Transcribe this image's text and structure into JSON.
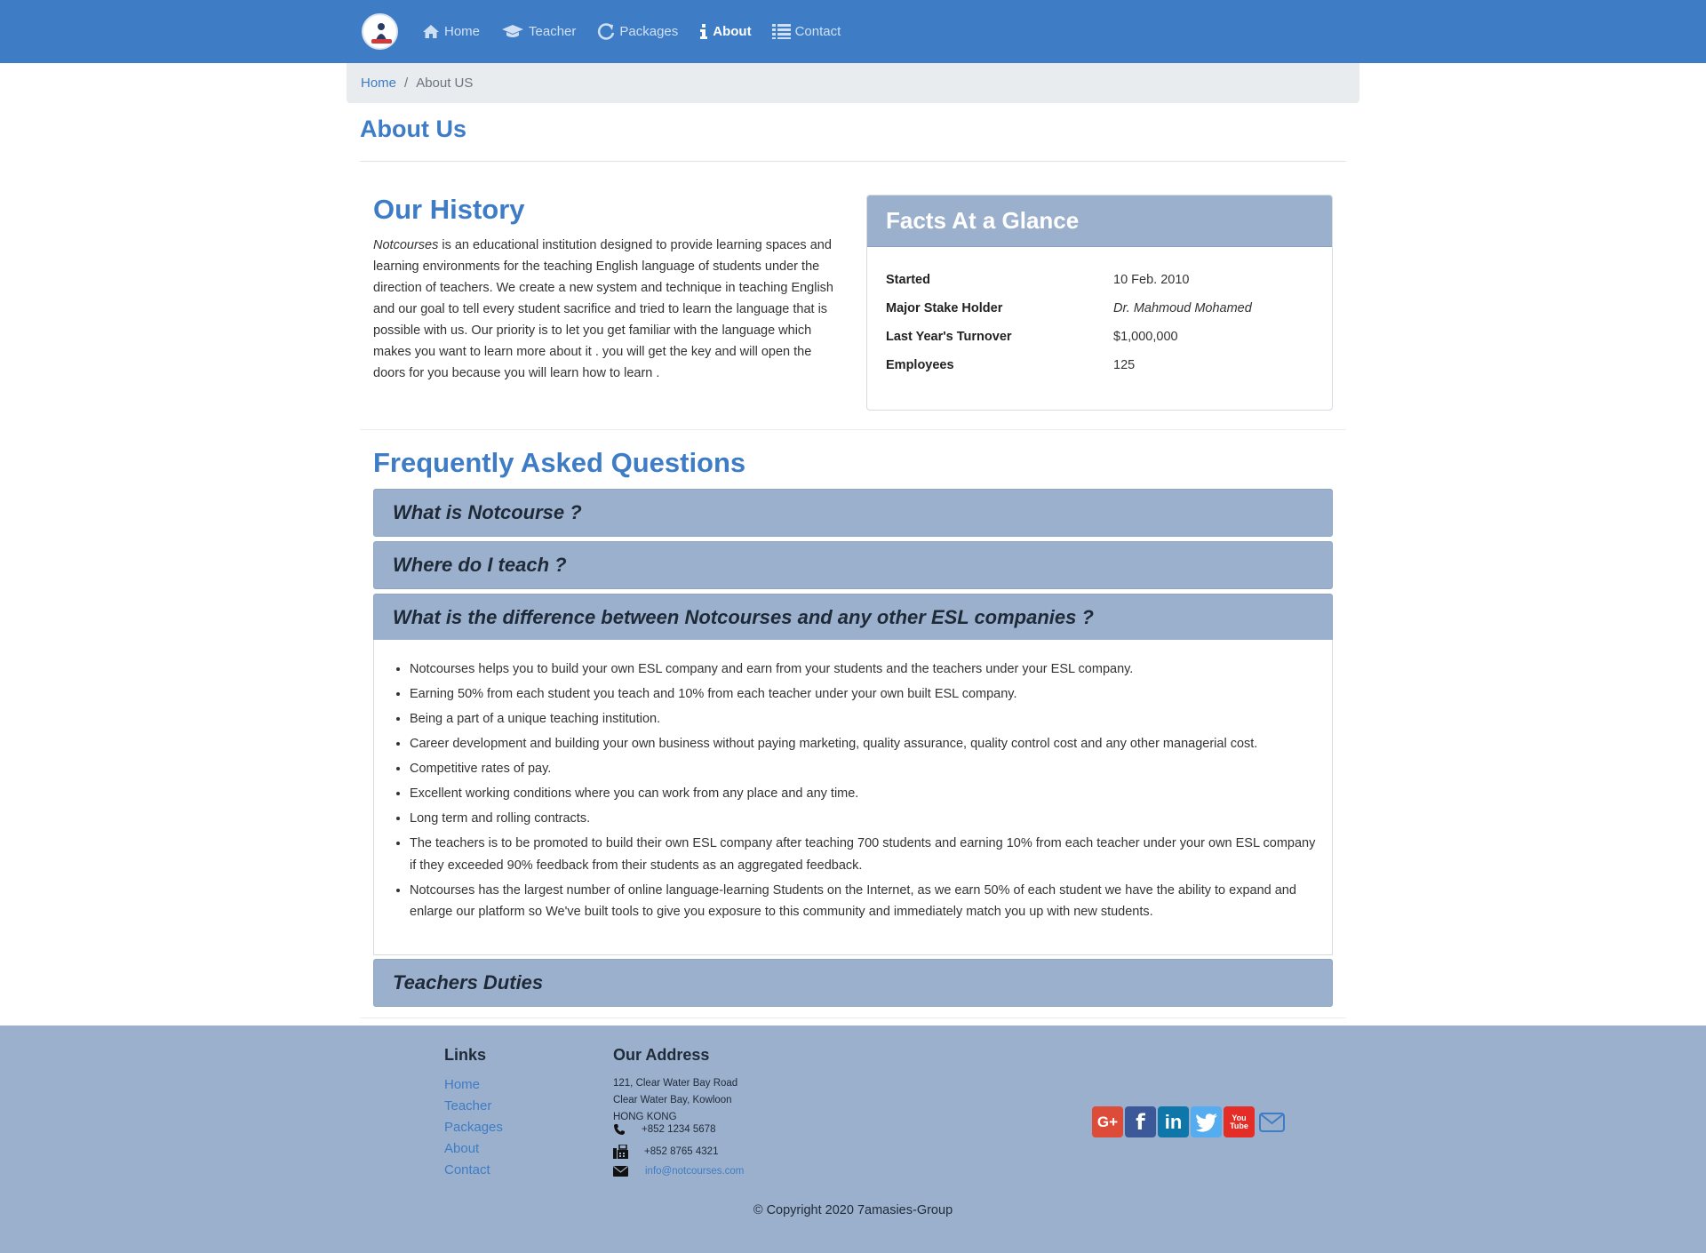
{
  "nav": {
    "items": [
      {
        "label": "Home",
        "icon": "home-icon"
      },
      {
        "label": "Teacher",
        "icon": "graduation-cap-icon"
      },
      {
        "label": "Packages",
        "icon": "refresh-icon"
      },
      {
        "label": "About",
        "icon": "info-icon"
      },
      {
        "label": "Contact",
        "icon": "list-icon"
      }
    ],
    "active": "About"
  },
  "breadcrumb": {
    "home": "Home",
    "separator": "/",
    "current": "About US"
  },
  "page_title": "About Us",
  "history": {
    "title": "Our History",
    "brand": "Notcourses",
    "text": " is an educational institution designed to provide learning spaces and learning environments for the teaching English language of students under the direction of teachers. We create a new system and technique in teaching English and our goal to tell every student sacrifice and tried to learn the language that is possible with us. Our priority is to let you get familiar with the language which makes you want to learn more about it . you will get the key and will open the doors for you because you will learn how to learn ."
  },
  "facts": {
    "title": "Facts At a Glance",
    "rows": [
      {
        "label": "Started",
        "value": "10 Feb. 2010"
      },
      {
        "label": "Major Stake Holder",
        "value": "Dr. Mahmoud Mohamed"
      },
      {
        "label": "Last Year's Turnover",
        "value": "$1,000,000"
      },
      {
        "label": "Employees",
        "value": "125"
      }
    ]
  },
  "faq": {
    "title": "Frequently Asked Questions",
    "questions": [
      "What is Notcourse ?",
      "Where do I teach ?",
      "What is the difference between Notcourses and any other ESL companies ?",
      "Teachers Duties"
    ],
    "expanded_index": 2,
    "answer_items": [
      "Notcourses helps you to build your own ESL company and earn from your students and the teachers under your ESL company.",
      "Earning 50% from each student you teach and 10% from each teacher under your own built ESL company.",
      "Being a part of a unique teaching institution.",
      "Career development and building your own business without paying marketing, quality assurance, quality control cost and any other managerial cost.",
      "Competitive rates of pay.",
      "Excellent working conditions where you can work from any place and any time.",
      "Long term and rolling contracts.",
      "The teachers is to be promoted to build their own ESL company after teaching 700 students and earning 10% from each teacher under your own ESL company if they exceeded 90% feedback from their students as an aggregated feedback.",
      "Notcourses has the largest number of online language-learning Students on the Internet, as we earn 50% of each student we have the ability to expand and enlarge our platform so We've built tools to give you exposure to this community and immediately match you up with new students."
    ]
  },
  "footer": {
    "links_title": "Links",
    "links": [
      "Home",
      "Teacher",
      "Packages",
      "About",
      "Contact"
    ],
    "address_title": "Our Address",
    "address_lines": [
      "121, Clear Water Bay Road",
      "Clear Water Bay, Kowloon",
      "HONG KONG"
    ],
    "phone": "+852 1234 5678",
    "fax": "+852 8765 4321",
    "email": "info@notcourses.com",
    "socials": [
      {
        "name": "google-plus-icon",
        "label": "G+",
        "color": "#dd4b39"
      },
      {
        "name": "facebook-icon",
        "label": "f",
        "color": "#3b5998"
      },
      {
        "name": "linkedin-icon",
        "label": "in",
        "color": "#0e76a8"
      },
      {
        "name": "twitter-icon",
        "label": "",
        "color": "#55acee"
      },
      {
        "name": "youtube-icon",
        "label": "You Tube",
        "color": "#e52d27"
      },
      {
        "name": "mail-icon",
        "label": "",
        "color": "#3e7cc5"
      }
    ],
    "copyright": "© Copyright 2020 7amasies-Group"
  },
  "colors": {
    "brand_blue": "#3e7cc5",
    "panel_blue": "#9bb0cc",
    "breadcrumb_bg": "#e9ecef"
  }
}
